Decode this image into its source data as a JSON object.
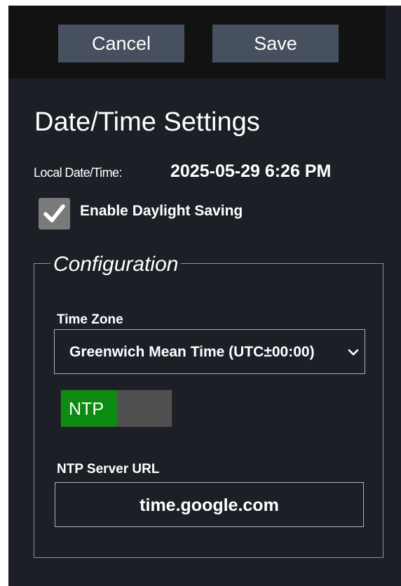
{
  "toolbar": {
    "cancel_label": "Cancel",
    "save_label": "Save"
  },
  "page": {
    "title": "Date/Time Settings"
  },
  "local_datetime": {
    "label": "Local Date/Time:",
    "value": "2025-05-29 6:26 PM"
  },
  "daylight_saving": {
    "label": "Enable Daylight Saving",
    "checked": true,
    "icon": "checkmark-icon"
  },
  "configuration": {
    "legend": "Configuration",
    "time_zone": {
      "label": "Time Zone",
      "selected": "Greenwich Mean Time (UTC±00:00)",
      "icon": "chevron-down-icon"
    },
    "ntp_toggle": {
      "label": "NTP",
      "enabled": true,
      "on_color": "#0d8a12"
    },
    "ntp_server": {
      "label": "NTP Server URL",
      "value": "time.google.com"
    }
  },
  "colors": {
    "panel_background": "#1c1f26",
    "header_background": "#121212",
    "button_background": "#46505f",
    "checkbox_background": "#7a7a7a"
  }
}
